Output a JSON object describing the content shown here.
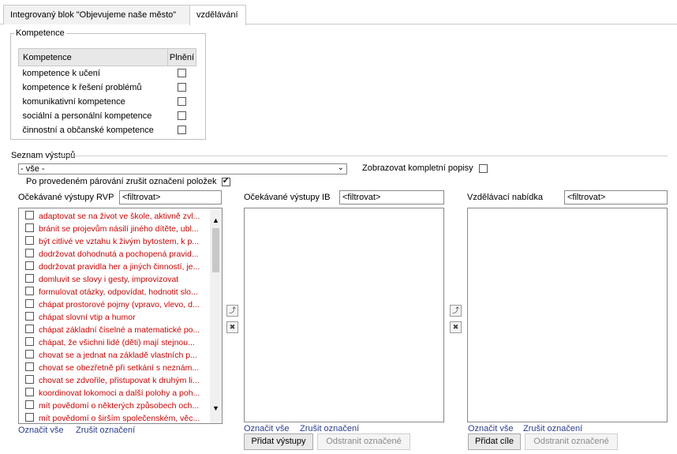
{
  "tabs": [
    {
      "label": "Integrovaný blok \"Objevujeme naše město\""
    },
    {
      "label": "vzdělávání"
    }
  ],
  "kompetence": {
    "legend": "Kompetence",
    "header_name": "Kompetence",
    "header_plneni": "Plnění",
    "rows": [
      {
        "label": "kompetence k učení",
        "checked": false
      },
      {
        "label": "kompetence k řešení problémů",
        "checked": false
      },
      {
        "label": "komunikativní kompetence",
        "checked": false
      },
      {
        "label": "sociální a personální kompetence",
        "checked": false
      },
      {
        "label": "činnostní a občanské kompetence",
        "checked": false
      }
    ]
  },
  "seznam": {
    "label": "Seznam výstupů",
    "select_value": "- vše -",
    "kompletni_label": "Zobrazovat kompletní popisy",
    "kompletni_checked": false,
    "parovani_label": "Po provedeném párování zrušit označení položek",
    "parovani_checked": true
  },
  "rvp": {
    "label": "Očekávané výstupy RVP",
    "filter_placeholder": "<filtrovat>",
    "items": [
      "adaptovat se na život ve škole, aktivně zvl...",
      "bránit se projevům násilí jiného dítěte, ubl...",
      "být citlivé ve vztahu k živým bytostem, k p...",
      "dodržovat dohodnutá a pochopená pravid...",
      "dodržovat pravidla her a jiných činností, je...",
      "domluvit se slovy i gesty, improvizovat",
      "formulovat otázky, odpovídat, hodnotit slo...",
      "chápat prostorové pojmy (vpravo, vlevo, d...",
      "chápat slovní vtip a humor",
      "chápat základní číselné a matematické po...",
      "chápat, že všichni lidé (děti) mají stejnou...",
      "chovat se a jednat na základě vlastních p...",
      "chovat se obezřetně při setkání s neznám...",
      "chovat se zdvořile, přistupovat k druhým li...",
      "koordinovat lokomoci a další polohy a poh...",
      "mít povědomí o některých způsobech och...",
      "mít povědomí o širším společenském, věc..."
    ],
    "select_all": "Označit vše",
    "deselect_all": "Zrušit označení"
  },
  "ib": {
    "label": "Očekávané výstupy IB",
    "filter_placeholder": "<filtrovat>",
    "select_all": "Označit vše",
    "deselect_all": "Zrušit označení",
    "add_button": "Přidat výstupy",
    "remove_button": "Odstranit označené"
  },
  "vzdelavaci": {
    "label": "Vzdělávací nabídka",
    "filter_placeholder": "<filtrovat>",
    "select_all": "Označit vše",
    "deselect_all": "Zrušit označení",
    "add_button": "Přidat cíle",
    "remove_button": "Odstranit označené"
  },
  "colors": {
    "rvp_item_text": "#d00000",
    "link": "#2a3c8f"
  },
  "icons": {
    "pair": "pair-icon",
    "unpair": "unpair-icon"
  }
}
